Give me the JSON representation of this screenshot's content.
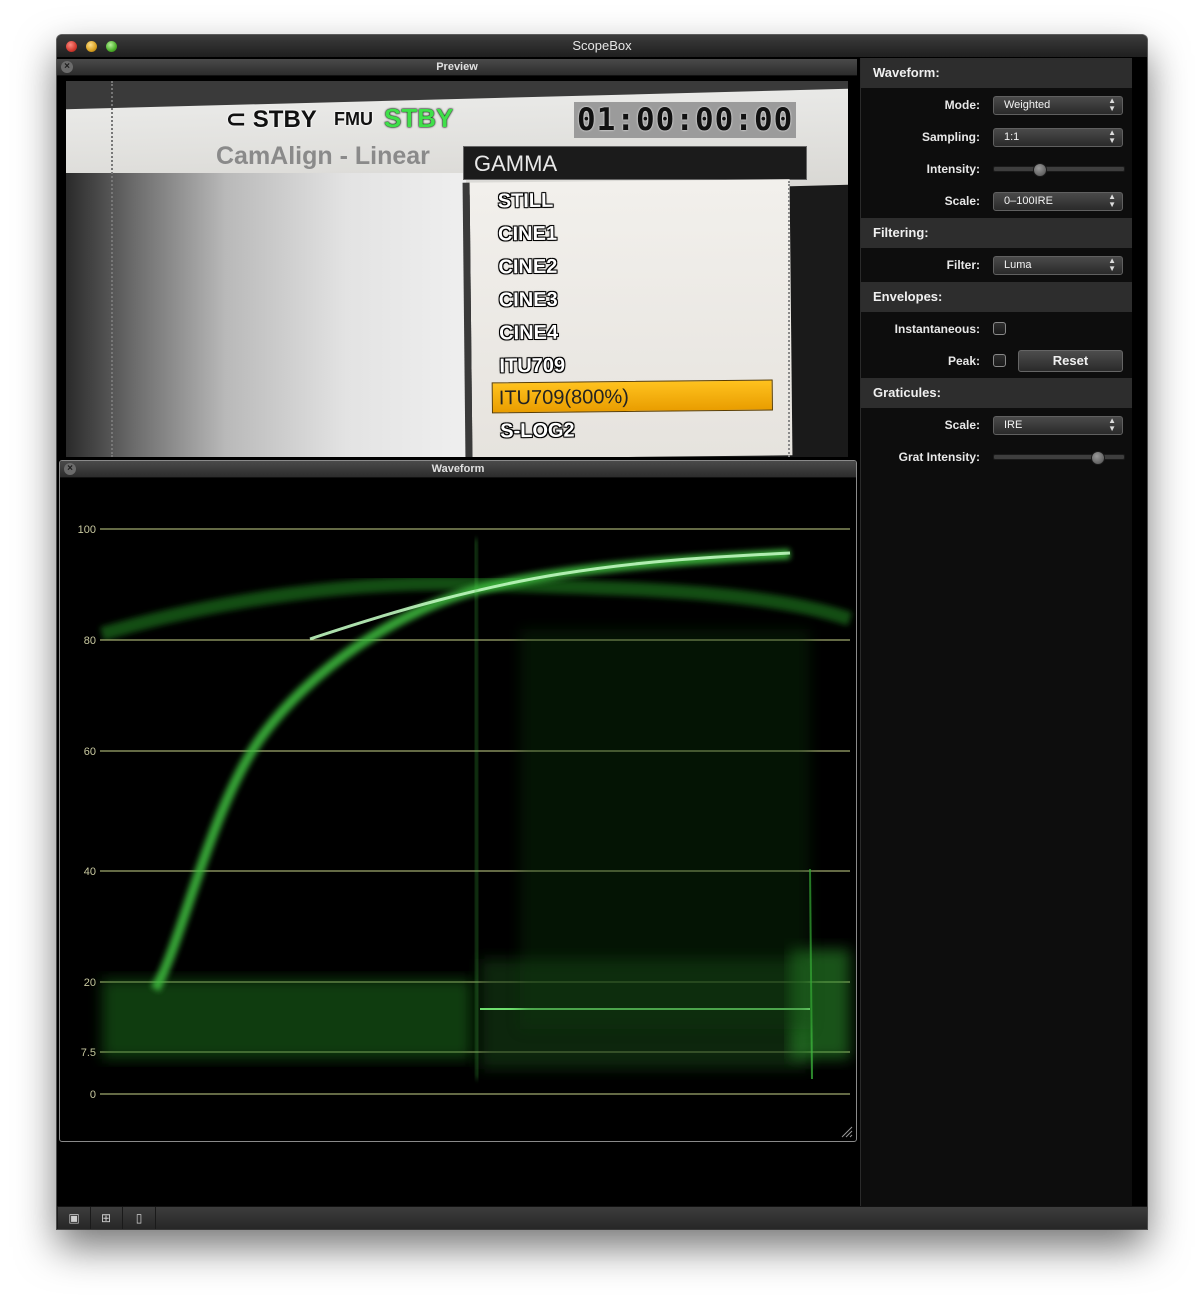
{
  "window": {
    "title": "ScopeBox"
  },
  "preview": {
    "header": "Preview",
    "osd_stby_left": "STBY",
    "osd_fmu": "FMU",
    "osd_stby_right": "STBY",
    "timecode": "01:00:00:00",
    "camalign_text": "CamAlign - Linear",
    "menu_title": "GAMMA",
    "menu_items": [
      "STILL",
      "CINE1",
      "CINE2",
      "CINE3",
      "CINE4",
      "ITU709",
      "ITU709(800%)",
      "S-LOG2"
    ],
    "selected_item": "ITU709(800%)"
  },
  "waveform": {
    "header": "Waveform",
    "graticule_labels": [
      "100",
      "80",
      "60",
      "40",
      "20",
      "7.5",
      "0"
    ],
    "trace_color": "#3fbf3f",
    "graticule_color": "#c9d38a"
  },
  "sidebar": {
    "waveform_section": "Waveform:",
    "mode_label": "Mode:",
    "mode_value": "Weighted",
    "sampling_label": "Sampling:",
    "sampling_value": "1:1",
    "intensity_label": "Intensity:",
    "intensity_level": 0.33,
    "scale_label": "Scale:",
    "scale_value": "0–100IRE",
    "filtering_section": "Filtering:",
    "filter_label": "Filter:",
    "filter_value": "Luma",
    "envelopes_section": "Envelopes:",
    "instantaneous_label": "Instantaneous:",
    "peak_label": "Peak:",
    "reset_label": "Reset",
    "graticules_section": "Graticules:",
    "grat_scale_label": "Scale:",
    "grat_scale_value": "IRE",
    "grat_intensity_label": "Grat Intensity:",
    "grat_intensity_level": 0.82
  }
}
